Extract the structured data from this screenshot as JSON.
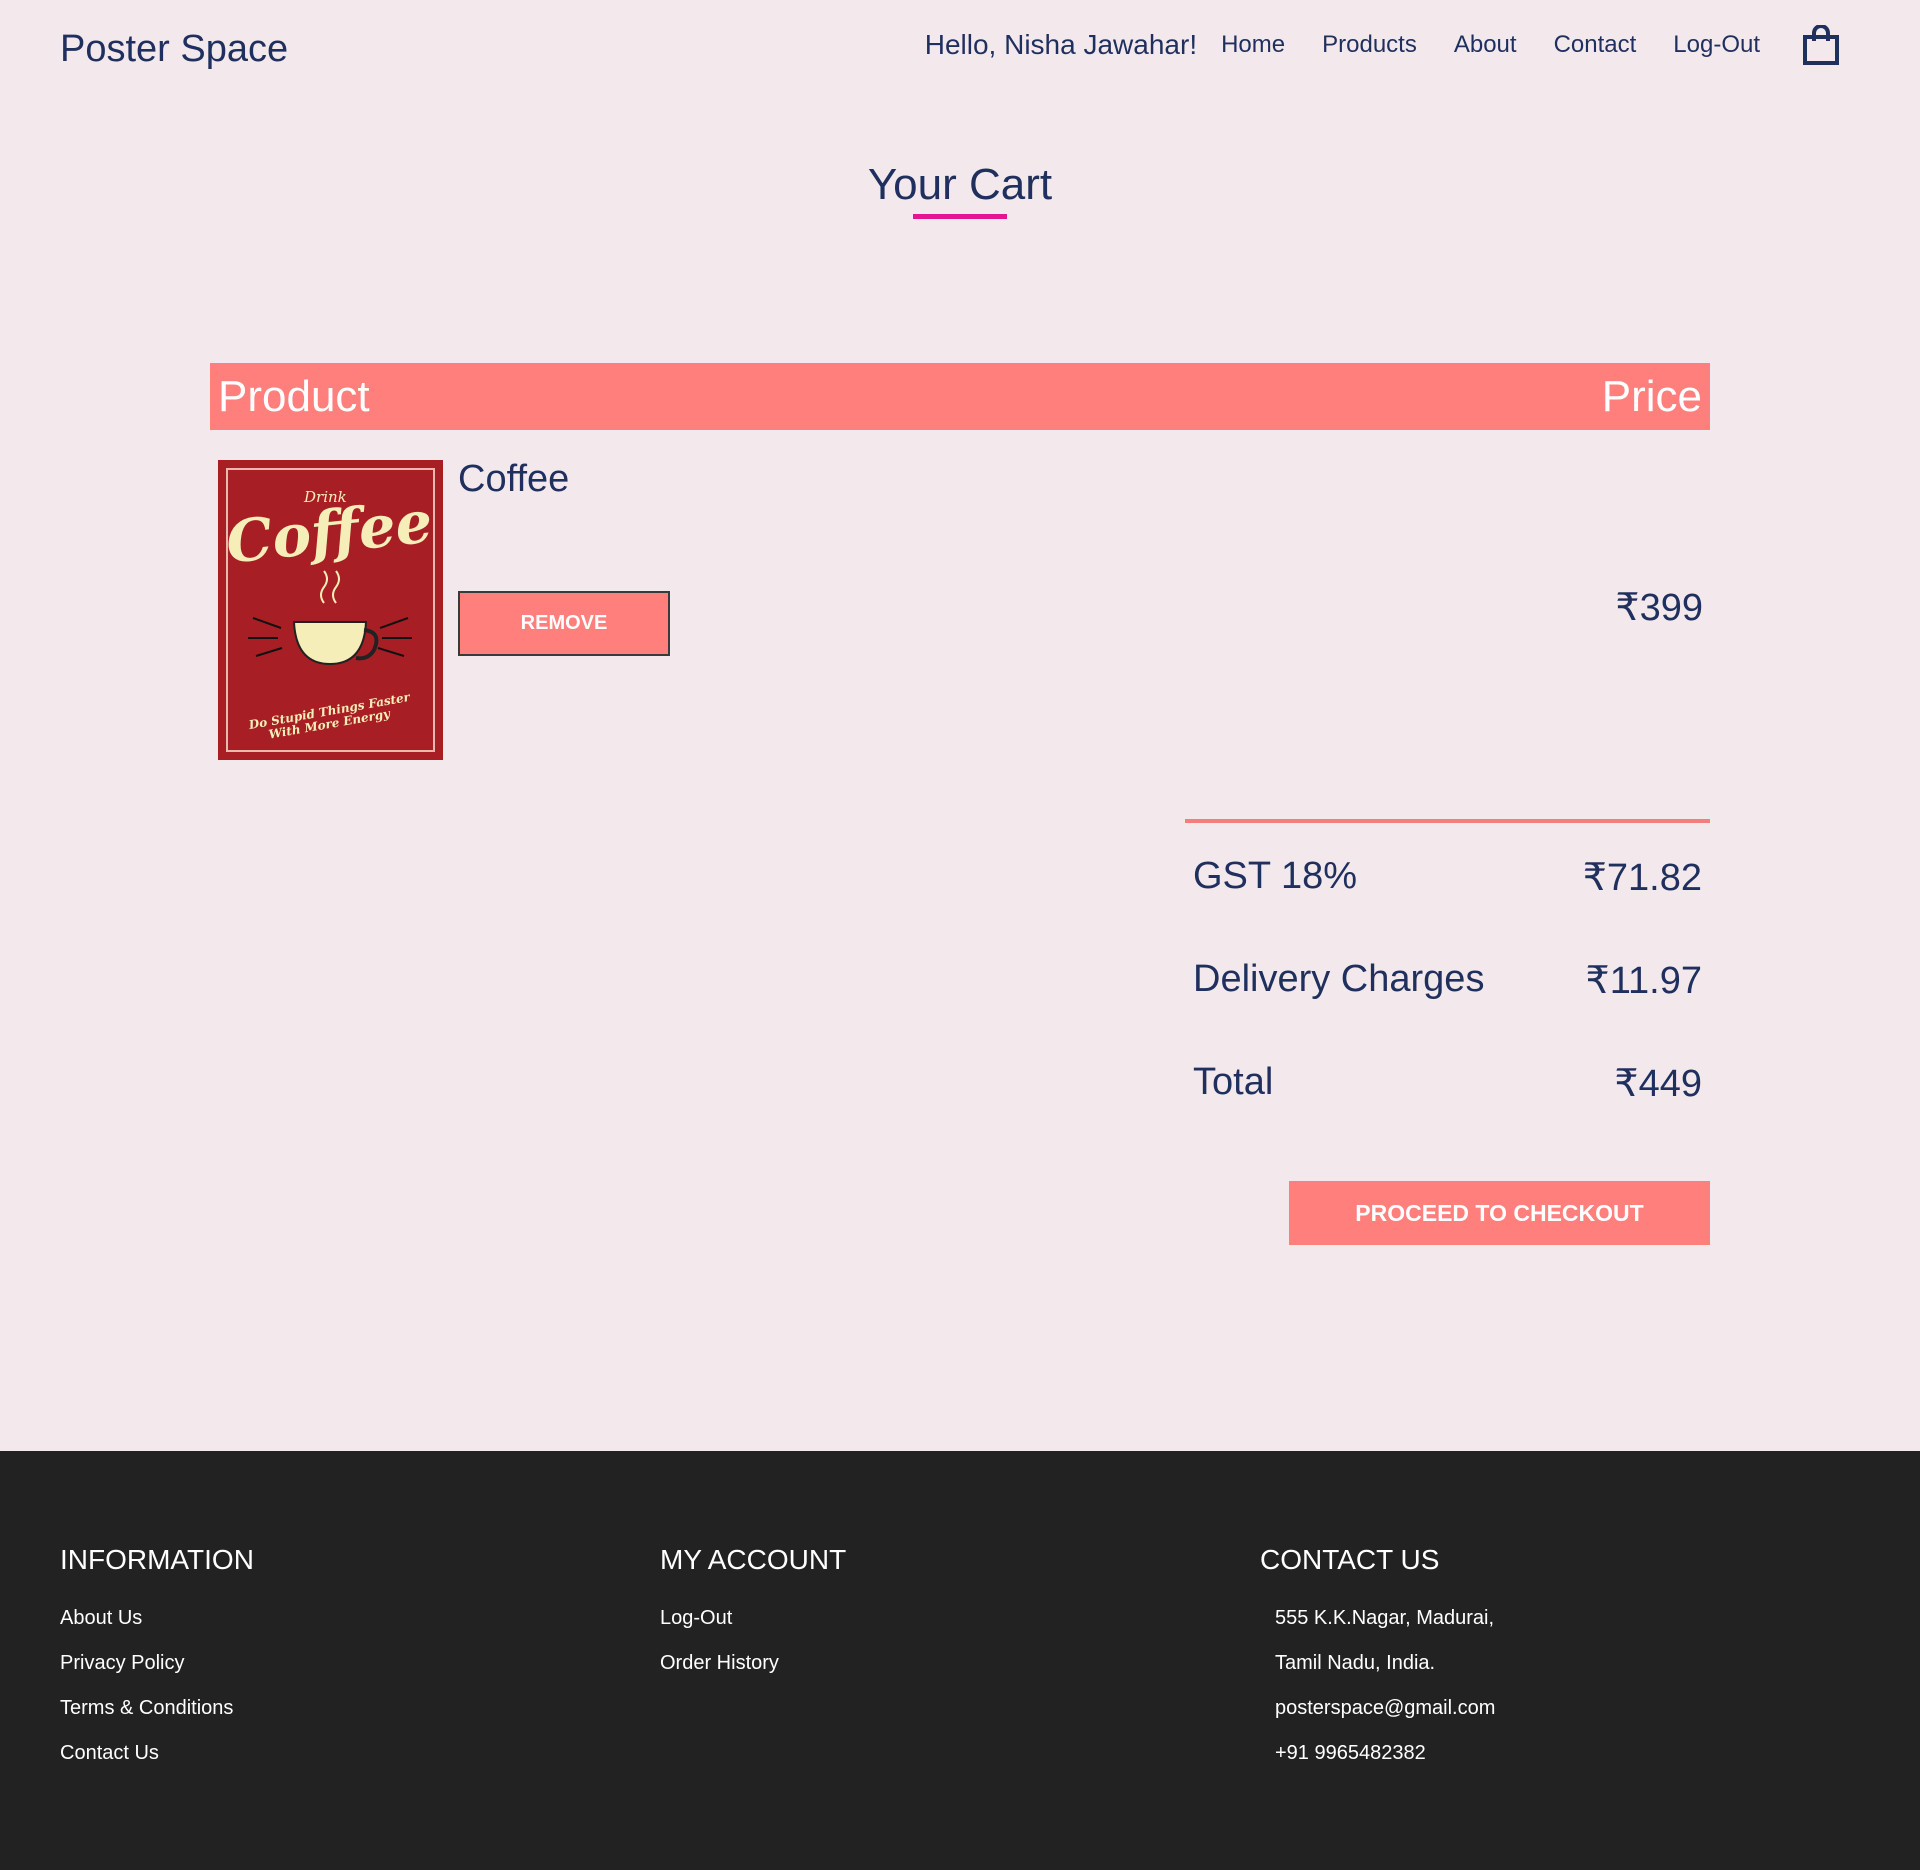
{
  "header": {
    "brand": "Poster Space",
    "greeting": "Hello, Nisha Jawahar!",
    "nav": [
      "Home",
      "Products",
      "About",
      "Contact",
      "Log-Out"
    ],
    "cart_icon": "shopping-bag-icon"
  },
  "page": {
    "title": "Your Cart"
  },
  "table": {
    "col_product": "Product",
    "col_price": "Price"
  },
  "cart_items": [
    {
      "name": "Coffee",
      "price": "₹399",
      "remove_label": "REMOVE",
      "poster": {
        "line1": "Drink",
        "line2": "Coffee",
        "line3": "Do Stupid Things Faster",
        "line4": "With More Energy"
      }
    }
  ],
  "summary": {
    "gst_label": "GST 18%",
    "gst_value": "₹71.82",
    "delivery_label": "Delivery Charges",
    "delivery_value": "₹11.97",
    "total_label": "Total",
    "total_value": "₹449"
  },
  "checkout_label": "PROCEED TO CHECKOUT",
  "footer": {
    "information": {
      "heading": "INFORMATION",
      "links": [
        "About Us",
        "Privacy Policy",
        "Terms & Conditions",
        "Contact Us"
      ]
    },
    "account": {
      "heading": "MY ACCOUNT",
      "links": [
        "Log-Out",
        "Order History"
      ]
    },
    "contact": {
      "heading": "CONTACT US",
      "lines": [
        "555 K.K.Nagar, Madurai,",
        "Tamil Nadu, India.",
        "posterspace@gmail.com",
        "+91 9965482382"
      ]
    }
  },
  "colors": {
    "accent": "#ff7f7d",
    "underline": "#e4158f",
    "text": "#1f2f5e",
    "background": "#f3e9ec",
    "footer": "#222222",
    "poster_red": "#a81e25",
    "poster_cream": "#f5eeb8"
  }
}
